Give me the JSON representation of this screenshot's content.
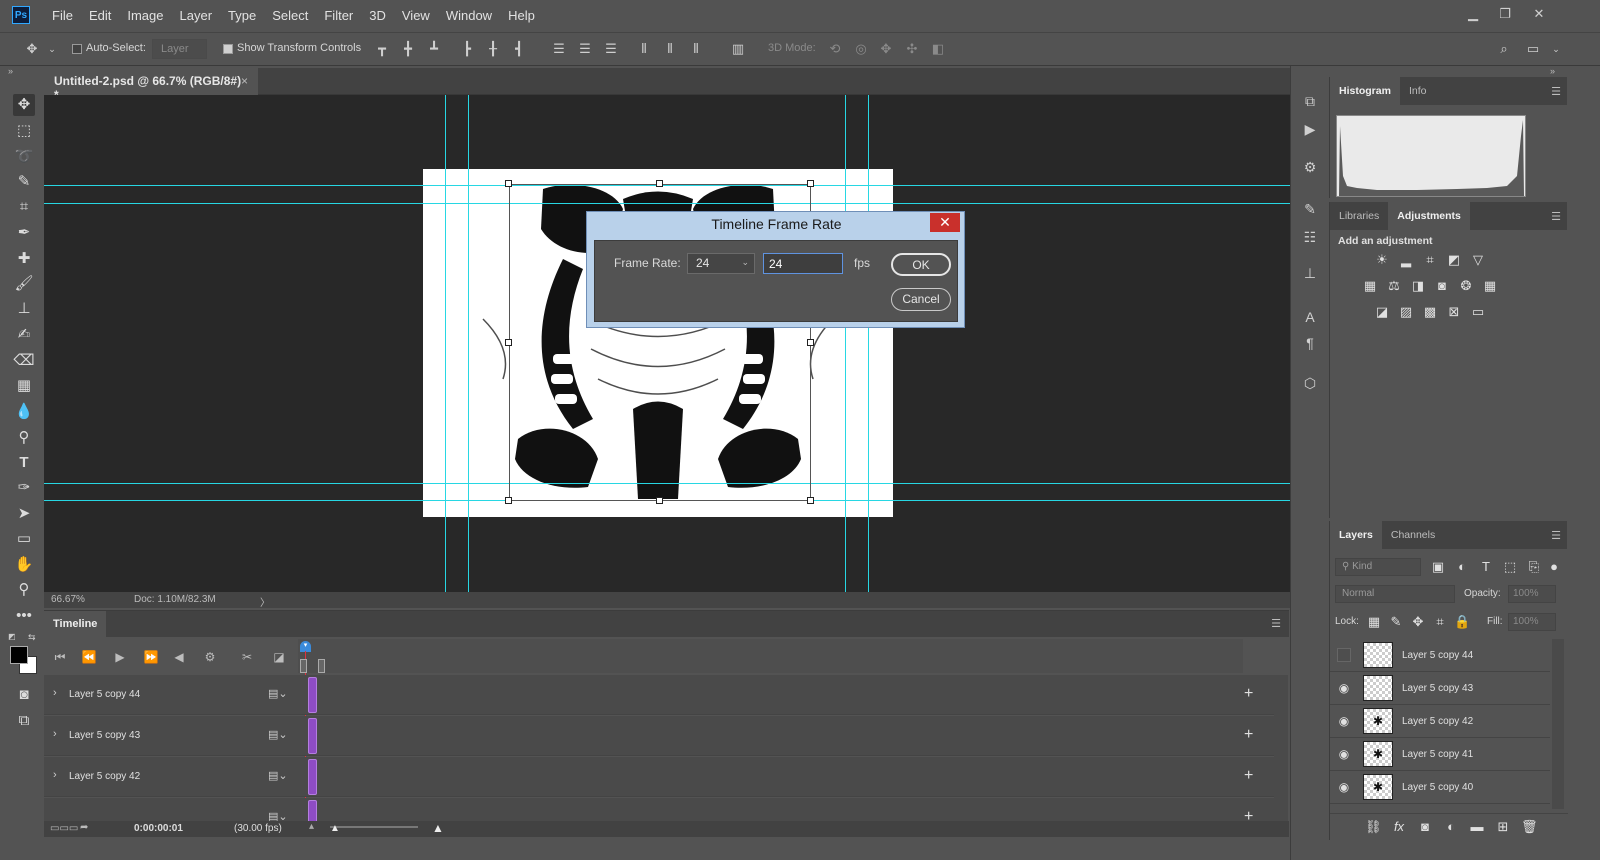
{
  "menu": [
    "File",
    "Edit",
    "Image",
    "Layer",
    "Type",
    "Select",
    "Filter",
    "3D",
    "View",
    "Window",
    "Help"
  ],
  "window_controls": {
    "minimize": "▁",
    "restore": "❐",
    "close": "✕"
  },
  "options": {
    "auto_select_label": "Auto-Select:",
    "auto_select_target": "Layer",
    "show_transform_label": "Show Transform Controls",
    "mode_3d_label": "3D Mode:"
  },
  "document_tab": {
    "title": "Untitled-2.psd @ 66.7% (RGB/8#) *",
    "close": "×"
  },
  "status": {
    "zoom": "66.67%",
    "doc": "Doc: 1.10M/82.3M",
    "arrow": "〉"
  },
  "dialog": {
    "title": "Timeline Frame Rate",
    "close": "✕",
    "frame_rate_label": "Frame Rate:",
    "frame_rate_selected": "24",
    "frame_rate_value": "24",
    "unit": "fps",
    "ok_label": "OK",
    "cancel_label": "Cancel"
  },
  "histogram_panel": {
    "tabs": [
      "Histogram",
      "Info"
    ]
  },
  "adjustments_panel": {
    "tabs": [
      "Libraries",
      "Adjustments"
    ],
    "heading": "Add an adjustment"
  },
  "layers_panel": {
    "tabs": [
      "Layers",
      "Channels"
    ],
    "kind_placeholder": "Kind",
    "blend_mode": "Normal",
    "opacity_label": "Opacity:",
    "opacity_value": "100%",
    "lock_label": "Lock:",
    "fill_label": "Fill:",
    "fill_value": "100%",
    "layers": [
      {
        "name": "Layer 5 copy 44",
        "visible": false
      },
      {
        "name": "Layer 5 copy 43",
        "visible": true
      },
      {
        "name": "Layer 5 copy 42",
        "visible": true
      },
      {
        "name": "Layer 5 copy 41",
        "visible": true
      },
      {
        "name": "Layer 5 copy 40",
        "visible": true
      }
    ]
  },
  "timeline": {
    "tab": "Timeline",
    "tracks": [
      "Layer 5 copy 44",
      "Layer 5 copy 43",
      "Layer 5 copy 42"
    ],
    "timecode": "0:00:00:01",
    "fps_display": "(30.00 fps)"
  }
}
